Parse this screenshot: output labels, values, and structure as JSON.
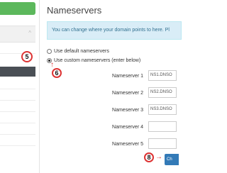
{
  "sidebar": {
    "top_button_label": "",
    "panel_chevron": "chevron-up-icon",
    "step_marker": "5"
  },
  "main": {
    "title": "Nameservers",
    "info_text": "You can change where your domain points to here. Pl",
    "options": {
      "default_label": "Use default nameservers",
      "custom_label": "Use custom nameservers (enter below)",
      "custom_step": "6",
      "selected": "custom"
    },
    "nameservers": [
      {
        "label": "Nameserver 1",
        "value": "NS1.DNSO"
      },
      {
        "label": "Nameserver 2",
        "value": "NS2.DNSO"
      },
      {
        "label": "Nameserver 3",
        "value": "NS3.DNSO"
      },
      {
        "label": "Nameserver 4",
        "value": ""
      },
      {
        "label": "Nameserver 5",
        "value": ""
      }
    ],
    "save_step": "8",
    "save_button_label": "Ch"
  },
  "colors": {
    "accent_green": "#5cb85c",
    "info_bg": "#d9edf7",
    "primary_blue": "#337ab7",
    "marker_red": "#dd3333",
    "active_item": "#4a4f55"
  }
}
